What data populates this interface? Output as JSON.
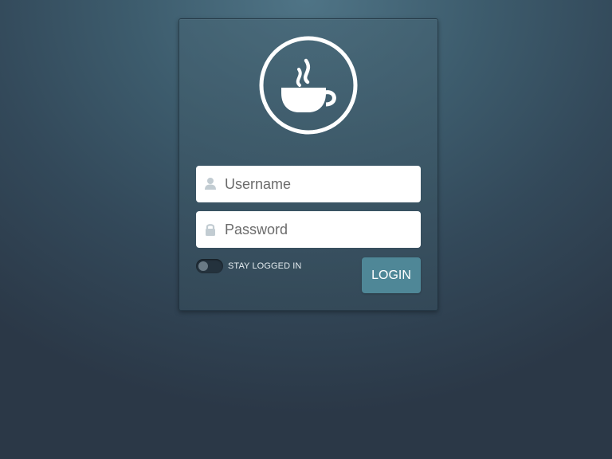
{
  "login_panel": {
    "logo_icon": "coffee-cup-icon",
    "username": {
      "icon": "user-icon",
      "placeholder": "Username",
      "value": ""
    },
    "password": {
      "icon": "lock-icon",
      "placeholder": "Password",
      "value": ""
    },
    "stay_logged_in": {
      "label": "STAY LOGGED IN",
      "checked": false
    },
    "login_button": {
      "label": "LOGIN"
    }
  },
  "colors": {
    "button": "#4f8797",
    "background_light": "#4f7486",
    "background_dark": "#2b3847",
    "toggle_track": "#24323d"
  }
}
